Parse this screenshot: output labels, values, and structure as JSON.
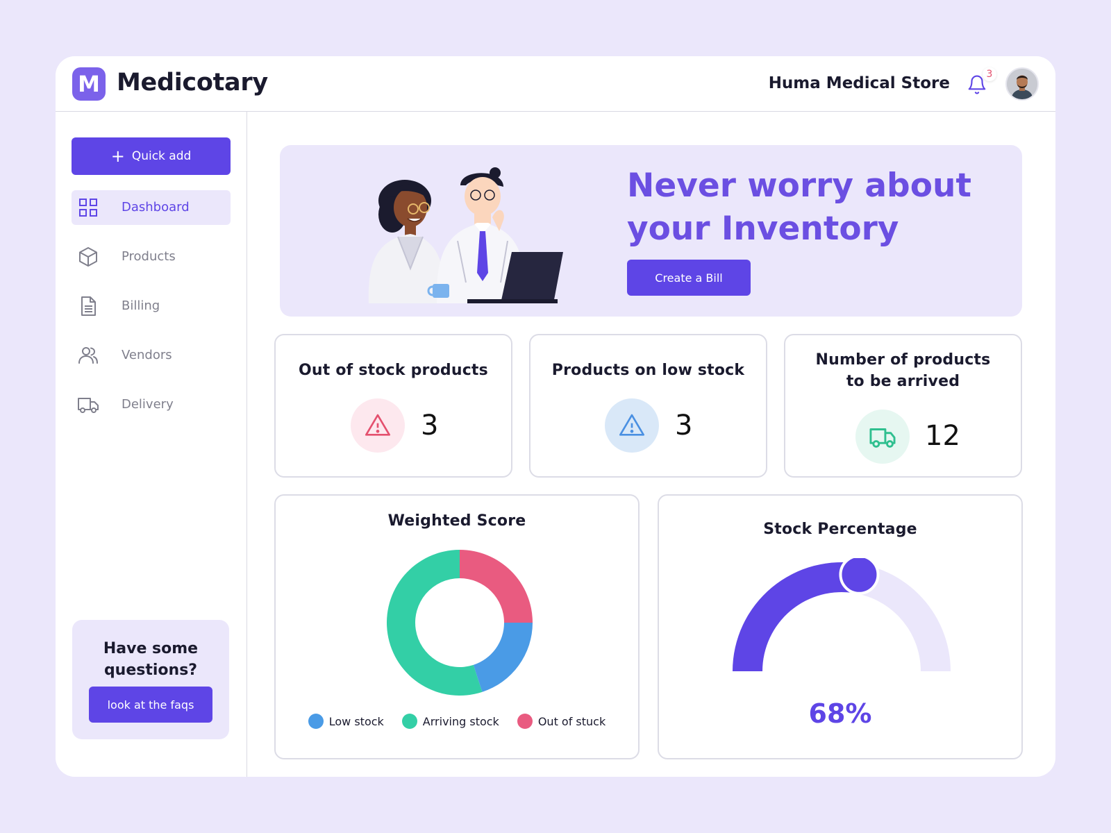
{
  "header": {
    "logo_letter": "M",
    "app_name": "Medicotary",
    "store_name": "Huma Medical Store",
    "notification_count": "3"
  },
  "sidebar": {
    "quick_add_label": "Quick add",
    "items": [
      {
        "label": "Dashboard",
        "icon": "grid-icon",
        "active": true
      },
      {
        "label": "Products",
        "icon": "box-icon",
        "active": false
      },
      {
        "label": "Billing",
        "icon": "document-icon",
        "active": false
      },
      {
        "label": "Vendors",
        "icon": "users-icon",
        "active": false
      },
      {
        "label": "Delivery",
        "icon": "truck-icon",
        "active": false
      }
    ],
    "faq": {
      "title": "Have some questions?",
      "button_label": "look at the faqs"
    }
  },
  "banner": {
    "title": "Never worry about your Inventory",
    "button_label": "Create a Bill"
  },
  "stats": [
    {
      "title": "Out of stock products",
      "value": "3",
      "icon": "warning-icon",
      "color": "#e4506e",
      "bg": "#fde8ee"
    },
    {
      "title": "Products on low stock",
      "value": "3",
      "icon": "warning-icon",
      "color": "#4a90e2",
      "bg": "#d9e8f8"
    },
    {
      "title": "Number of products to be arrived",
      "value": "12",
      "icon": "truck-icon",
      "color": "#2fbf8f",
      "bg": "#e6f7f1"
    }
  ],
  "colors": {
    "accent": "#5e45e6",
    "accent_light": "#ebe7fb",
    "low_stock": "#4a9be6",
    "arriving_stock": "#33cfa6",
    "out_of_stock": "#e95b80"
  },
  "chart_data": [
    {
      "type": "pie",
      "title": "Weighted Score",
      "categories": [
        "Low stock",
        "Arriving stock",
        "Out of stuck"
      ],
      "values": [
        20,
        55,
        25
      ],
      "colors": [
        "#4a9be6",
        "#33cfa6",
        "#e95b80"
      ],
      "legend": "bottom"
    },
    {
      "type": "gauge",
      "title": "Stock Percentage",
      "value_label": "68%",
      "value": 68,
      "max": 100,
      "colors": [
        "#5e45e6",
        "#ebe7fb"
      ]
    }
  ]
}
